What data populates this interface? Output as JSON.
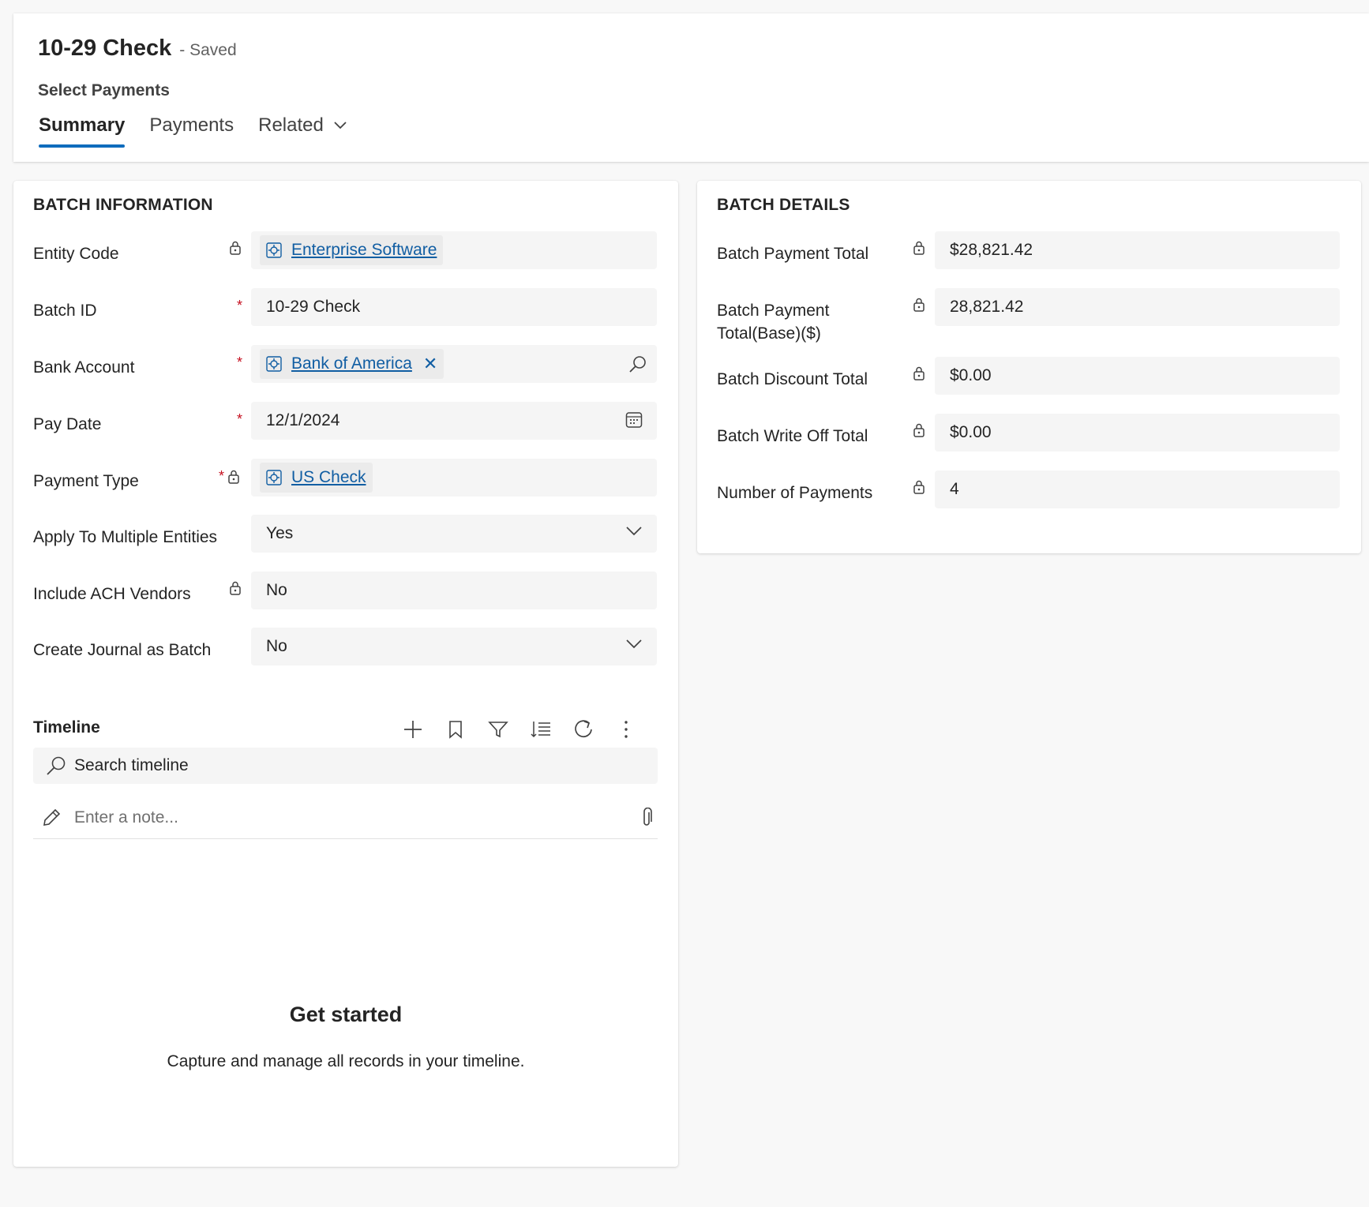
{
  "header": {
    "title": "10-29 Check",
    "status": "- Saved",
    "subtitle": "Select Payments",
    "tabs": [
      {
        "label": "Summary"
      },
      {
        "label": "Payments"
      },
      {
        "label": "Related"
      }
    ]
  },
  "batch_info": {
    "title": "BATCH INFORMATION",
    "fields": [
      {
        "label": "Entity Code",
        "value": "Enterprise Software"
      },
      {
        "label": "Batch ID",
        "value": "10-29 Check"
      },
      {
        "label": "Bank Account",
        "value": "Bank of America",
        "remove_glyph": "✕"
      },
      {
        "label": "Pay Date",
        "value": "12/1/2024"
      },
      {
        "label": "Payment Type",
        "value": "US Check"
      },
      {
        "label": "Apply To Multiple Entities",
        "value": "Yes"
      },
      {
        "label": "Include ACH Vendors",
        "value": "No"
      },
      {
        "label": "Create Journal as Batch",
        "value": "No"
      }
    ],
    "required_mark": "*"
  },
  "batch_details": {
    "title": "BATCH DETAILS",
    "fields": [
      {
        "label": "Batch Payment Total",
        "value": "$28,821.42"
      },
      {
        "label": "Batch Payment Total(Base)($)",
        "label_line1": "Batch Payment",
        "label_line2": "Total(Base)($)",
        "value": "28,821.42"
      },
      {
        "label": "Batch Discount Total",
        "value": "$0.00"
      },
      {
        "label": "Batch Write Off Total",
        "value": "$0.00"
      },
      {
        "label": "Number of Payments",
        "value": "4"
      }
    ]
  },
  "timeline": {
    "title": "Timeline",
    "search_placeholder": "Search timeline",
    "note_placeholder": "Enter a note...",
    "empty_title": "Get started",
    "empty_description": "Capture and manage all records in your timeline.",
    "tools": [
      "add-icon",
      "bookmark-icon",
      "filter-icon",
      "sort-list-icon",
      "refresh-icon",
      "more-vertical-icon"
    ]
  },
  "colors": {
    "accent": "#0f6cbd",
    "link": "#115ea3",
    "required": "#c50f1f",
    "field_bg": "#f5f5f5",
    "page_bg": "#f8f8f8"
  }
}
